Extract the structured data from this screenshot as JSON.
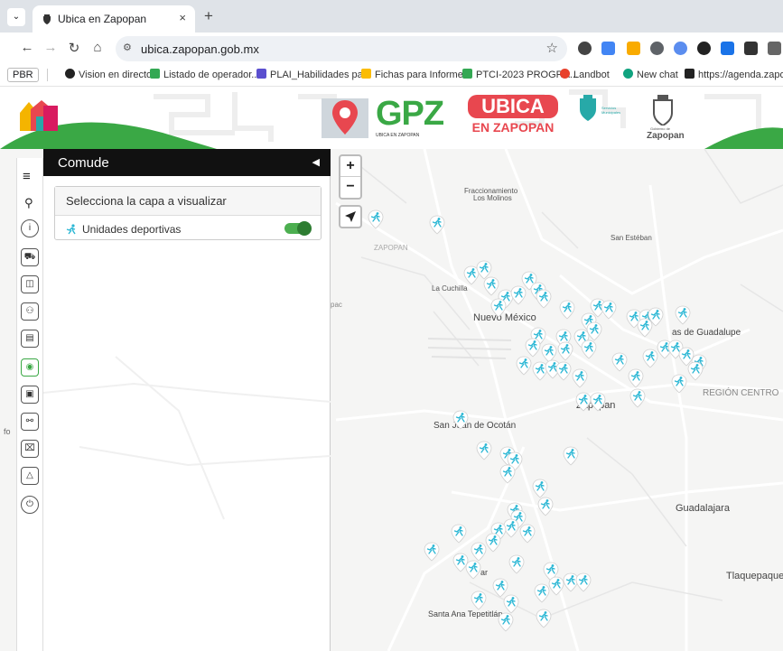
{
  "browser": {
    "tab_title": "Ubica en Zapopan",
    "tab_close": "×",
    "new_tab": "+",
    "url": "ubica.zapopan.gob.mx",
    "bookmarks": [
      {
        "label": "PBR"
      },
      {
        "label": "Vision en directo",
        "color": "#222222"
      },
      {
        "label": "Listado de operador...",
        "color": "#34a853"
      },
      {
        "label": "PLAI_Habilidades pa...",
        "color": "#5b4fcf"
      },
      {
        "label": "Fichas para Informe...",
        "color": "#fbbc04"
      },
      {
        "label": "PTCI-2023 PROGRA...",
        "color": "#34a853"
      },
      {
        "label": "Landbot",
        "color": "#e8412c"
      },
      {
        "label": "New chat",
        "color": "#10a37f"
      },
      {
        "label": "https://agenda.zapo...",
        "color": "#222222"
      }
    ]
  },
  "banner": {
    "gpz_text": "GPZ",
    "gpz_sub": "UBICA EN ZAPOPAN",
    "ubica_line1": "UBICA",
    "ubica_line2": "EN ZAPOPAN",
    "servicios_text": "Servicios Municipales",
    "gobierno_text": "Gobierno de",
    "zapopan_text": "Zapopan",
    "accent_red": "#e8474f",
    "accent_green": "#3aa845",
    "accent_teal": "#27a9a8"
  },
  "panel": {
    "title": "Comude",
    "layer_header": "Selecciona la capa a visualizar",
    "layer_item": "Unidades deportivas",
    "layer_enabled": true
  },
  "map": {
    "zoom_in": "+",
    "zoom_out": "−",
    "labels": [
      {
        "key": "fracc1",
        "text": "Fraccionamiento"
      },
      {
        "key": "fracc2",
        "text": "Los Molinos"
      },
      {
        "key": "zapopan",
        "text": "ZAPOPAN"
      },
      {
        "key": "san_esteban",
        "text": "San Estéban"
      },
      {
        "key": "la_cuchilla",
        "text": "La Cuchilla"
      },
      {
        "key": "pac",
        "text": "pac"
      },
      {
        "key": "nuevo_mexico",
        "text": "Nuevo México"
      },
      {
        "key": "guadalupe",
        "text": "as de Guadalupe"
      },
      {
        "key": "region_centro",
        "text": "REGIÓN CENTRO"
      },
      {
        "key": "zapopan_c",
        "text": "Zapopan"
      },
      {
        "key": "ocotan",
        "text": "San Juan de Ocotán"
      },
      {
        "key": "guadalajara",
        "text": "Guadalajara"
      },
      {
        "key": "tlaquepaque",
        "text": "Tlaquepaque"
      },
      {
        "key": "santa_ana",
        "text": "Santa Ana Tepetitlán"
      },
      {
        "key": "fo",
        "text": "fo"
      },
      {
        "key": "nar",
        "text": "ar"
      }
    ],
    "pin_color": "#29b6d4"
  }
}
